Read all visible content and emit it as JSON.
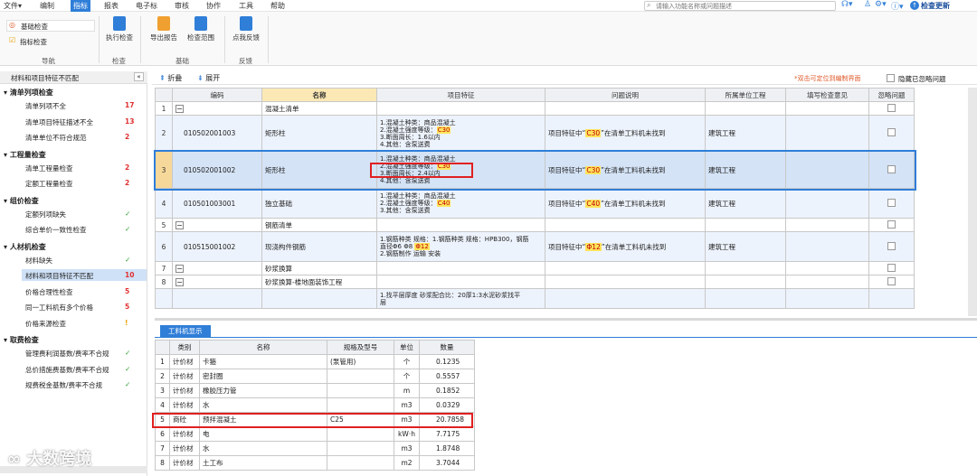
{
  "menu": [
    "文件▾",
    "编制",
    "指标",
    "报表",
    "电子标",
    "审核",
    "协作",
    "工具",
    "帮助"
  ],
  "menu_active_index": 2,
  "search": {
    "placeholder": "请输入功能名称或问题描述"
  },
  "top_right": {
    "check_update": "检查更新"
  },
  "ribbon": {
    "nav_items": [
      "基础检查",
      "指标检查"
    ],
    "nav_group": "导航",
    "run_check": "执行检查",
    "check_group": "检查",
    "export_report": "导出报告",
    "check_scope": "检查范围",
    "basic_group": "基础",
    "like_feedback": "点我反馈",
    "feedback_group": "反馈"
  },
  "left_panel": {
    "title": "材料和项目特征不匹配",
    "collapse": "«",
    "categories": [
      {
        "name": "清单列项检查",
        "items": [
          {
            "label": "清单列项不全",
            "count": "17",
            "status": "error"
          },
          {
            "label": "清单项目特征描述不全",
            "count": "13",
            "status": "error"
          },
          {
            "label": "清单单位不符合规范",
            "count": "2",
            "status": "error"
          }
        ]
      },
      {
        "name": "工程量检查",
        "items": [
          {
            "label": "清单工程量检查",
            "count": "2",
            "status": "error"
          },
          {
            "label": "定额工程量检查",
            "count": "2",
            "status": "error"
          }
        ]
      },
      {
        "name": "组价检查",
        "items": [
          {
            "label": "定额列项缺失",
            "count": "✓",
            "status": "ok"
          },
          {
            "label": "综合单价一致性检查",
            "count": "✓",
            "status": "ok"
          }
        ]
      },
      {
        "name": "人材机检查",
        "items": [
          {
            "label": "材料缺失",
            "count": "✓",
            "status": "ok"
          },
          {
            "label": "材料和项目特征不匹配",
            "count": "10",
            "status": "error"
          },
          {
            "label": "价格合理性检查",
            "count": "5",
            "status": "error"
          },
          {
            "label": "同一工料机有多个价格",
            "count": "5",
            "status": "error"
          },
          {
            "label": "价格来源检查",
            "count": "!",
            "status": "warn"
          }
        ]
      },
      {
        "name": "取费检查",
        "items": [
          {
            "label": "管理费利润基数/费率不合规",
            "count": "✓",
            "status": "ok"
          },
          {
            "label": "总价措施费基数/费率不合规",
            "count": "✓",
            "status": "ok"
          },
          {
            "label": "规费税金基数/费率不合规",
            "count": "✓",
            "status": "ok"
          }
        ]
      }
    ]
  },
  "toolbar2": {
    "fold": "折叠",
    "expand": "展开",
    "hint": "*双击可定位到编制界面",
    "hide_ignored": "隐藏已忽略问题"
  },
  "main_grid": {
    "headers": [
      "",
      "编码",
      "名称",
      "项目特征",
      "问题说明",
      "所属单位工程",
      "填写检查意见",
      "忽略问题"
    ],
    "rows": [
      {
        "type": "group",
        "num": "1",
        "name": "混凝土清单",
        "code": "",
        "feature": "",
        "issue": "",
        "unit": ""
      },
      {
        "type": "row",
        "num": "2",
        "code": "010502001003",
        "name": "矩形柱",
        "feature": [
          "1.混凝土种类：商品混凝土",
          "2.混凝土强度等级：C30",
          "3.断面周长：1.6以内",
          "4.其他：含泵送费"
        ],
        "issue": "项目特征中“C30”在清单工料机未找到",
        "issue_tag": "C30",
        "unit": "建筑工程"
      },
      {
        "type": "selrow",
        "num": "3",
        "code": "010502001002",
        "name": "矩形柱",
        "feature": [
          "1.混凝土种类：商品混凝土",
          "2.混凝土强度等级：C30",
          "3.断面周长：2.4以内",
          "4.其他：含泵送费"
        ],
        "issue": "项目特征中“C30”在清单工料机未找到",
        "issue_tag": "C30",
        "unit": "建筑工程"
      },
      {
        "type": "row",
        "num": "4",
        "code": "010501003001",
        "name": "独立基础",
        "feature": [
          "1.混凝土种类：商品混凝土",
          "2.混凝土强度等级：C40",
          "3.其他：含泵送费"
        ],
        "issue": "项目特征中“C40”在清单工料机未找到",
        "issue_tag": "C40",
        "unit": "建筑工程"
      },
      {
        "type": "group",
        "num": "5",
        "name": "钢筋清单"
      },
      {
        "type": "row",
        "num": "6",
        "code": "010515001002",
        "name": "现浇构件钢筋",
        "feature": [
          "1.钢筋种类 规格：1.钢筋种类 规格：HPB300，钢筋",
          "直径Φ6 Φ8 Φ12",
          "2.钢筋制作 运输 安装"
        ],
        "issue": "项目特征中“Φ12”在清单工料机未找到",
        "issue_tag": "Φ12",
        "unit": "建筑工程"
      },
      {
        "type": "group",
        "num": "7",
        "name": "砂浆换算"
      },
      {
        "type": "group",
        "num": "8",
        "name": "砂浆换算-楼地面装饰工程"
      },
      {
        "type": "row",
        "num": "",
        "code": "",
        "name": "",
        "feature": [
          "1.找平层厚度 砂浆配合比：20厚1:3水泥砂浆找平",
          "层"
        ],
        "issue": "",
        "issue_tag": "",
        "unit": ""
      }
    ]
  },
  "bottom_tab": "工料机显示",
  "bottom_grid": {
    "headers": [
      "",
      "类别",
      "名称",
      "规格及型号",
      "单位",
      "数量"
    ],
    "rows": [
      [
        "1",
        "计价材",
        "卡箍",
        "(泵管用)",
        "个",
        "0.1235"
      ],
      [
        "2",
        "计价材",
        "密封圈",
        "",
        "个",
        "0.5557"
      ],
      [
        "3",
        "计价材",
        "橡胶压力管",
        "",
        "m",
        "0.1852"
      ],
      [
        "4",
        "计价材",
        "水",
        "",
        "m3",
        "0.0329"
      ],
      [
        "5",
        "商砼",
        "预拌混凝土",
        "C25",
        "m3",
        "20.7858"
      ],
      [
        "6",
        "计价材",
        "电",
        "",
        "kW·h",
        "7.7175"
      ],
      [
        "7",
        "计价材",
        "水",
        "",
        "m3",
        "1.8748"
      ],
      [
        "8",
        "计价材",
        "土工布",
        "",
        "m2",
        "3.7044"
      ]
    ]
  },
  "watermark": "大数跨境",
  "colors": {
    "accent": "#2f7ed8",
    "error": "#e03030",
    "ok": "#2a9d2a",
    "warn": "#e8a000",
    "highlight": "#ffe45c",
    "redbox": "#e02020"
  }
}
